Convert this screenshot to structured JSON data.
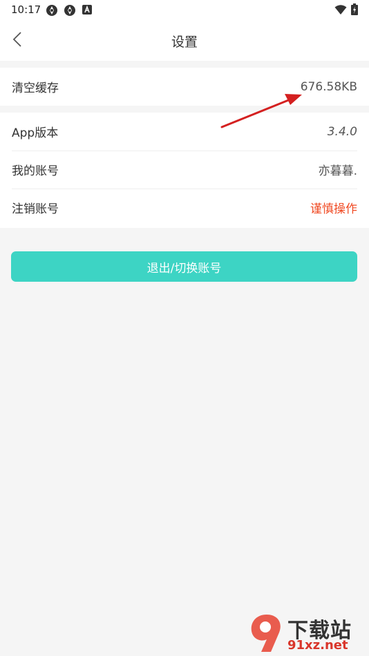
{
  "status_bar": {
    "time": "10:17",
    "left_icons": [
      "aperture-icon",
      "aperture-icon",
      "a-badge-icon"
    ],
    "right_icons": [
      "wifi-icon",
      "battery-icon"
    ]
  },
  "nav": {
    "title": "设置",
    "back_icon": "chevron-left-icon"
  },
  "settings": {
    "cache": {
      "label": "清空缓存",
      "value": "676.58KB"
    },
    "version": {
      "label": "App版本",
      "value": "3.4.0"
    },
    "account": {
      "label": "我的账号",
      "value": "亦暮暮."
    },
    "cancel": {
      "label": "注销账号",
      "value": "谨慎操作"
    }
  },
  "logout_button": {
    "label": "退出/切换账号"
  },
  "watermark": {
    "line1": "下载站",
    "line2": "91xz.net"
  },
  "colors": {
    "accent": "#3dd4c4",
    "danger": "#f04a23",
    "arrow": "#d42020"
  }
}
